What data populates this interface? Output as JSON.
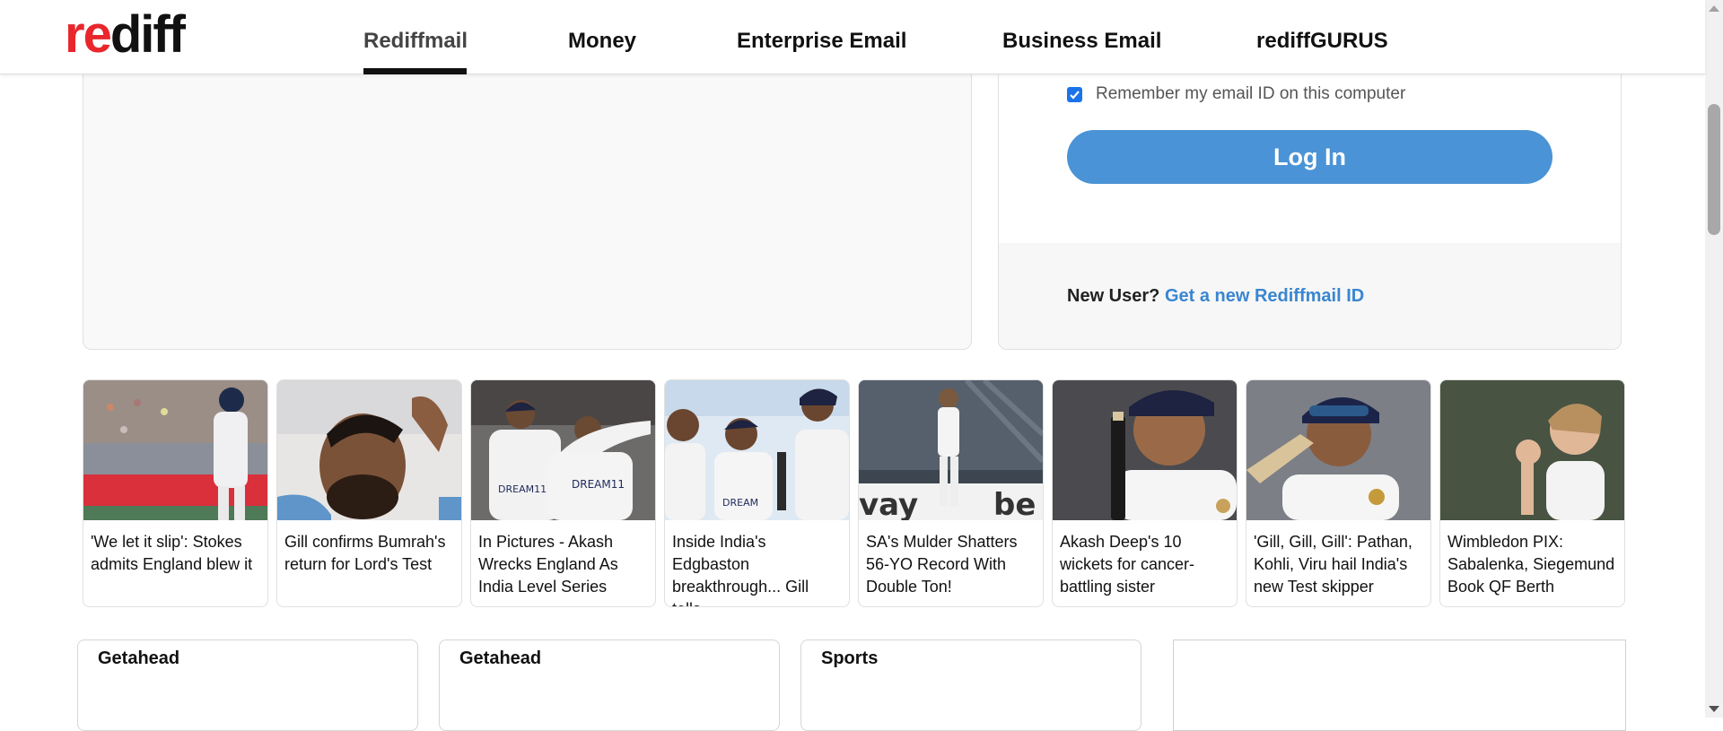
{
  "header": {
    "logo": {
      "red": "re",
      "black": "diff"
    },
    "nav": [
      "Rediffmail",
      "Money",
      "Enterprise Email",
      "Business Email",
      "rediffGURUS"
    ]
  },
  "login": {
    "remember_label": "Remember my email ID on this computer",
    "remember_checked": true,
    "login_button": "Log In",
    "new_user_prefix": "New User?",
    "new_user_link": "Get a new Rediffmail ID"
  },
  "news": [
    {
      "text": "'We let it slip': Stokes admits England blew it"
    },
    {
      "text": "Gill confirms Bumrah's return for Lord's Test"
    },
    {
      "text": "In Pictures - Akash Wrecks England As India Level Series"
    },
    {
      "text": "Inside India's Edgbaston breakthrough... Gill tells"
    },
    {
      "text": "SA's Mulder Shatters 56-YO Record With Double Ton!"
    },
    {
      "text": "Akash Deep's 10 wickets for cancer-battling sister"
    },
    {
      "text": "'Gill, Gill, Gill': Pathan, Kohli, Viru hail India's new Test skipper"
    },
    {
      "text": "Wimbledon PIX: Sabalenka, Siegemund Book QF Berth"
    }
  ],
  "sections": [
    "Getahead",
    "Getahead",
    "Sports"
  ],
  "colors": {
    "brand_red": "#e8262c",
    "login_button": "#4a93d6",
    "link": "#3a86d0"
  }
}
